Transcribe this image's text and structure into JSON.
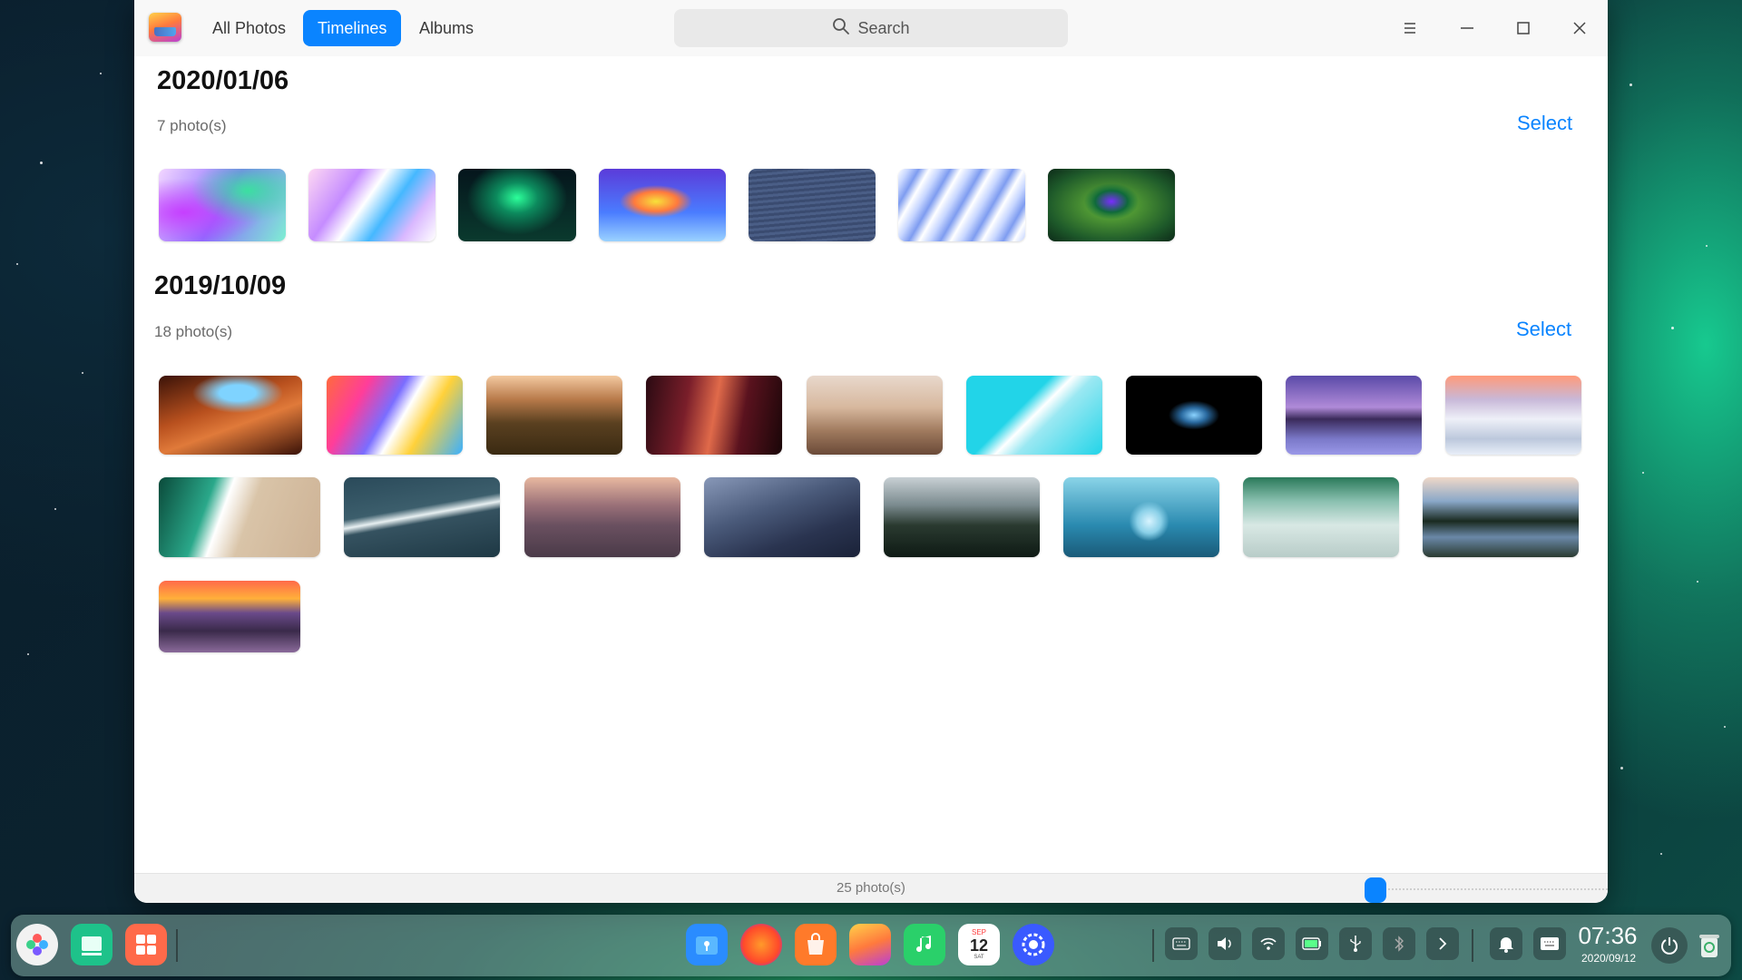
{
  "window": {
    "tabs": [
      {
        "label": "All Photos",
        "active": false
      },
      {
        "label": "Timelines",
        "active": true
      },
      {
        "label": "Albums",
        "active": false
      }
    ],
    "search": {
      "placeholder": "Search"
    },
    "controls": [
      "menu-icon",
      "minimize-icon",
      "maximize-icon",
      "close-icon"
    ]
  },
  "timeline": [
    {
      "date": "2020/01/06",
      "count": "7 photo(s)",
      "select_label": "Select"
    },
    {
      "date": "2019/10/09",
      "count": "18 photo(s)",
      "select_label": "Select"
    }
  ],
  "status": {
    "total": "25 photo(s)",
    "zoom_level": 0.0
  },
  "dock": {
    "apps": [
      "launcher-icon",
      "multitasking-icon",
      "workspace-icon",
      "file-manager-icon",
      "firefox-icon",
      "app-store-icon",
      "photos-icon",
      "music-icon",
      "calendar-icon",
      "settings-icon"
    ],
    "calendar": {
      "month": "SEP",
      "day": "12",
      "weekday": "SAT"
    },
    "tray": [
      "keyboard-icon",
      "volume-icon",
      "wifi-icon",
      "battery-icon",
      "usb-icon",
      "bluetooth-icon",
      "expand-icon",
      "notification-icon",
      "input-method-icon"
    ],
    "clock": {
      "time": "07:36",
      "date": "2020/09/12"
    }
  },
  "colors": {
    "accent": "#0a84ff",
    "window_bg": "#ffffff",
    "titlebar_bg": "#f8f8f8"
  }
}
